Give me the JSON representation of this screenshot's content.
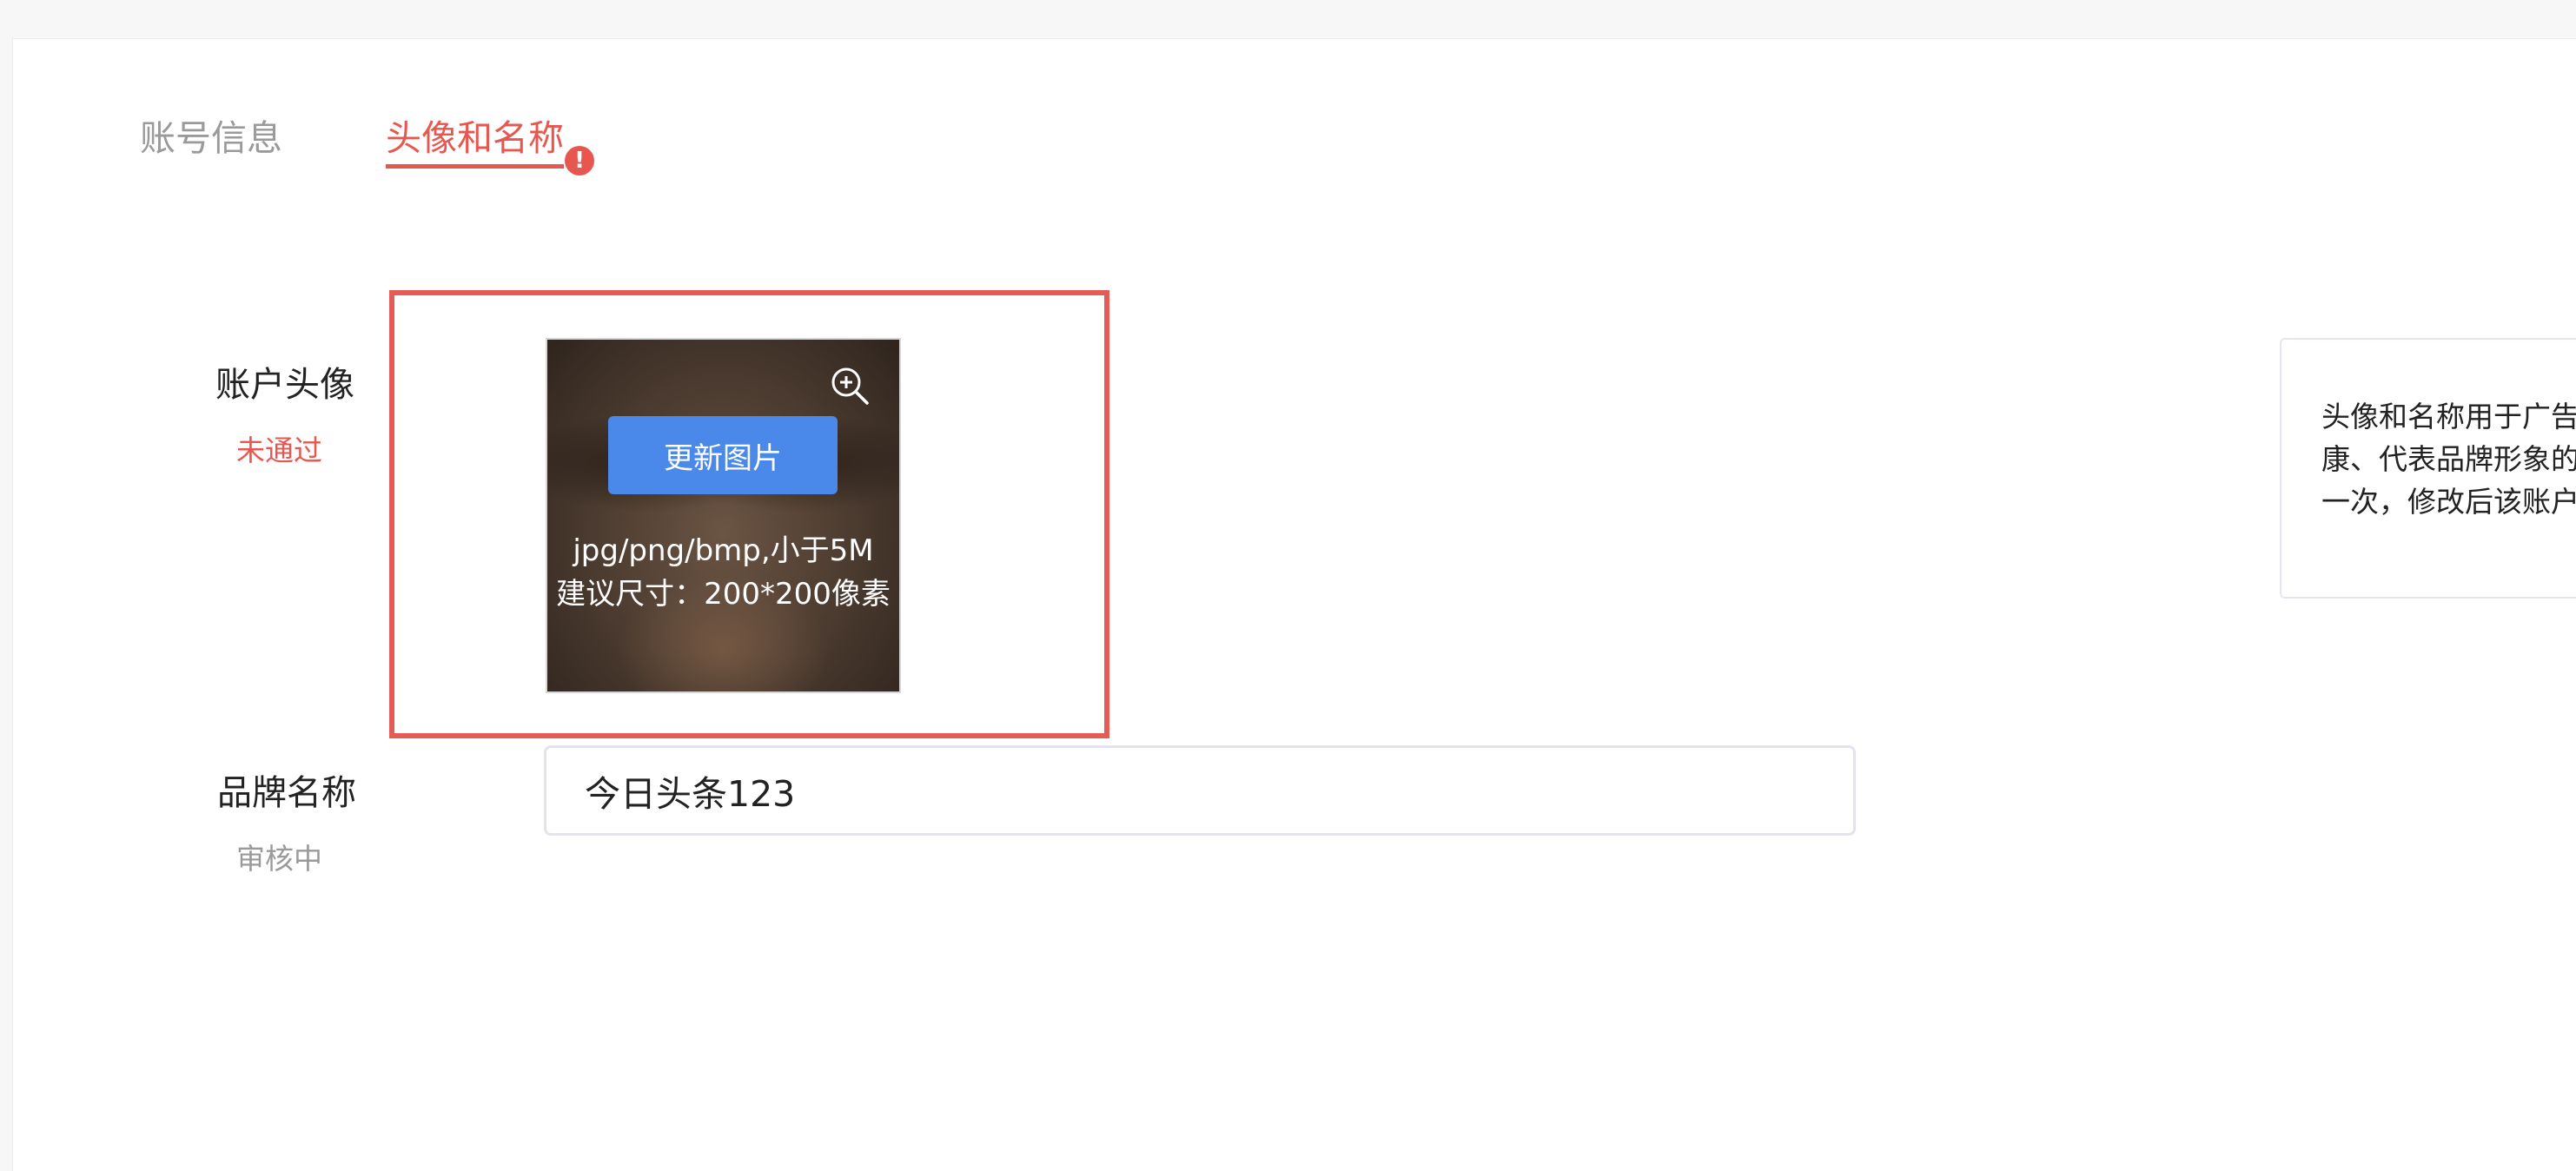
{
  "tabs": {
    "account_info": "账号信息",
    "avatar_and_name": "头像和名称",
    "badge": "!"
  },
  "avatar_field": {
    "label": "账户头像",
    "status": "未通过",
    "update_button": "更新图片",
    "hint_format": "jpg/png/bmp,小于5M",
    "hint_size": "建议尺寸：200*200像素"
  },
  "brand_field": {
    "label": "品牌名称",
    "status": "审核中",
    "value": "今日头条123"
  },
  "info_panel": {
    "line1": "头像和名称用于广告",
    "line2": "康、代表品牌形象的",
    "line3": "一次，修改后该账户"
  },
  "colors": {
    "accent": "#e8574f",
    "primary_button": "#4a88ea",
    "muted_text": "#9a9a9a"
  }
}
